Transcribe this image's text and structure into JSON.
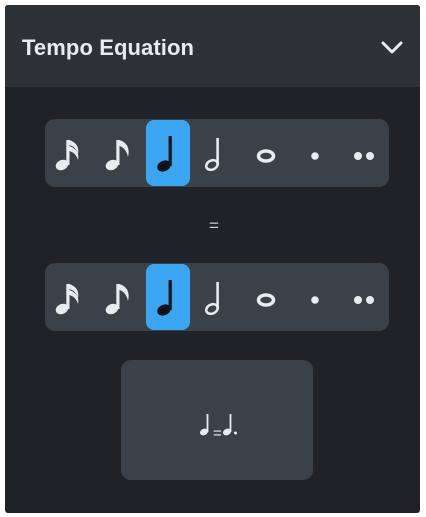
{
  "panel": {
    "title": "Tempo Equation",
    "collapse_icon": "chevron-down-icon"
  },
  "left_note_selector": {
    "options": [
      {
        "icon": "sixteenth-note-icon",
        "selected": false
      },
      {
        "icon": "eighth-note-icon",
        "selected": false
      },
      {
        "icon": "quarter-note-icon",
        "selected": true
      },
      {
        "icon": "half-note-icon",
        "selected": false
      },
      {
        "icon": "whole-note-icon",
        "selected": false
      },
      {
        "icon": "dot-icon",
        "selected": false
      },
      {
        "icon": "double-dot-icon",
        "selected": false
      }
    ]
  },
  "equals_label": "=",
  "right_note_selector": {
    "options": [
      {
        "icon": "sixteenth-note-icon",
        "selected": false
      },
      {
        "icon": "eighth-note-icon",
        "selected": false
      },
      {
        "icon": "quarter-note-icon",
        "selected": true
      },
      {
        "icon": "half-note-icon",
        "selected": false
      },
      {
        "icon": "whole-note-icon",
        "selected": false
      },
      {
        "icon": "dot-icon",
        "selected": false
      },
      {
        "icon": "double-dot-icon",
        "selected": false
      }
    ]
  },
  "equation_display": {
    "left_icon": "quarter-note-icon",
    "operator": "=",
    "right_icon": "dotted-quarter-note-icon"
  },
  "colors": {
    "panel_bg": "#1f2327",
    "header_bg": "#2d3237",
    "control_bg": "#3a4148",
    "accent": "#3aa6f2",
    "icon": "#e9ecef"
  }
}
